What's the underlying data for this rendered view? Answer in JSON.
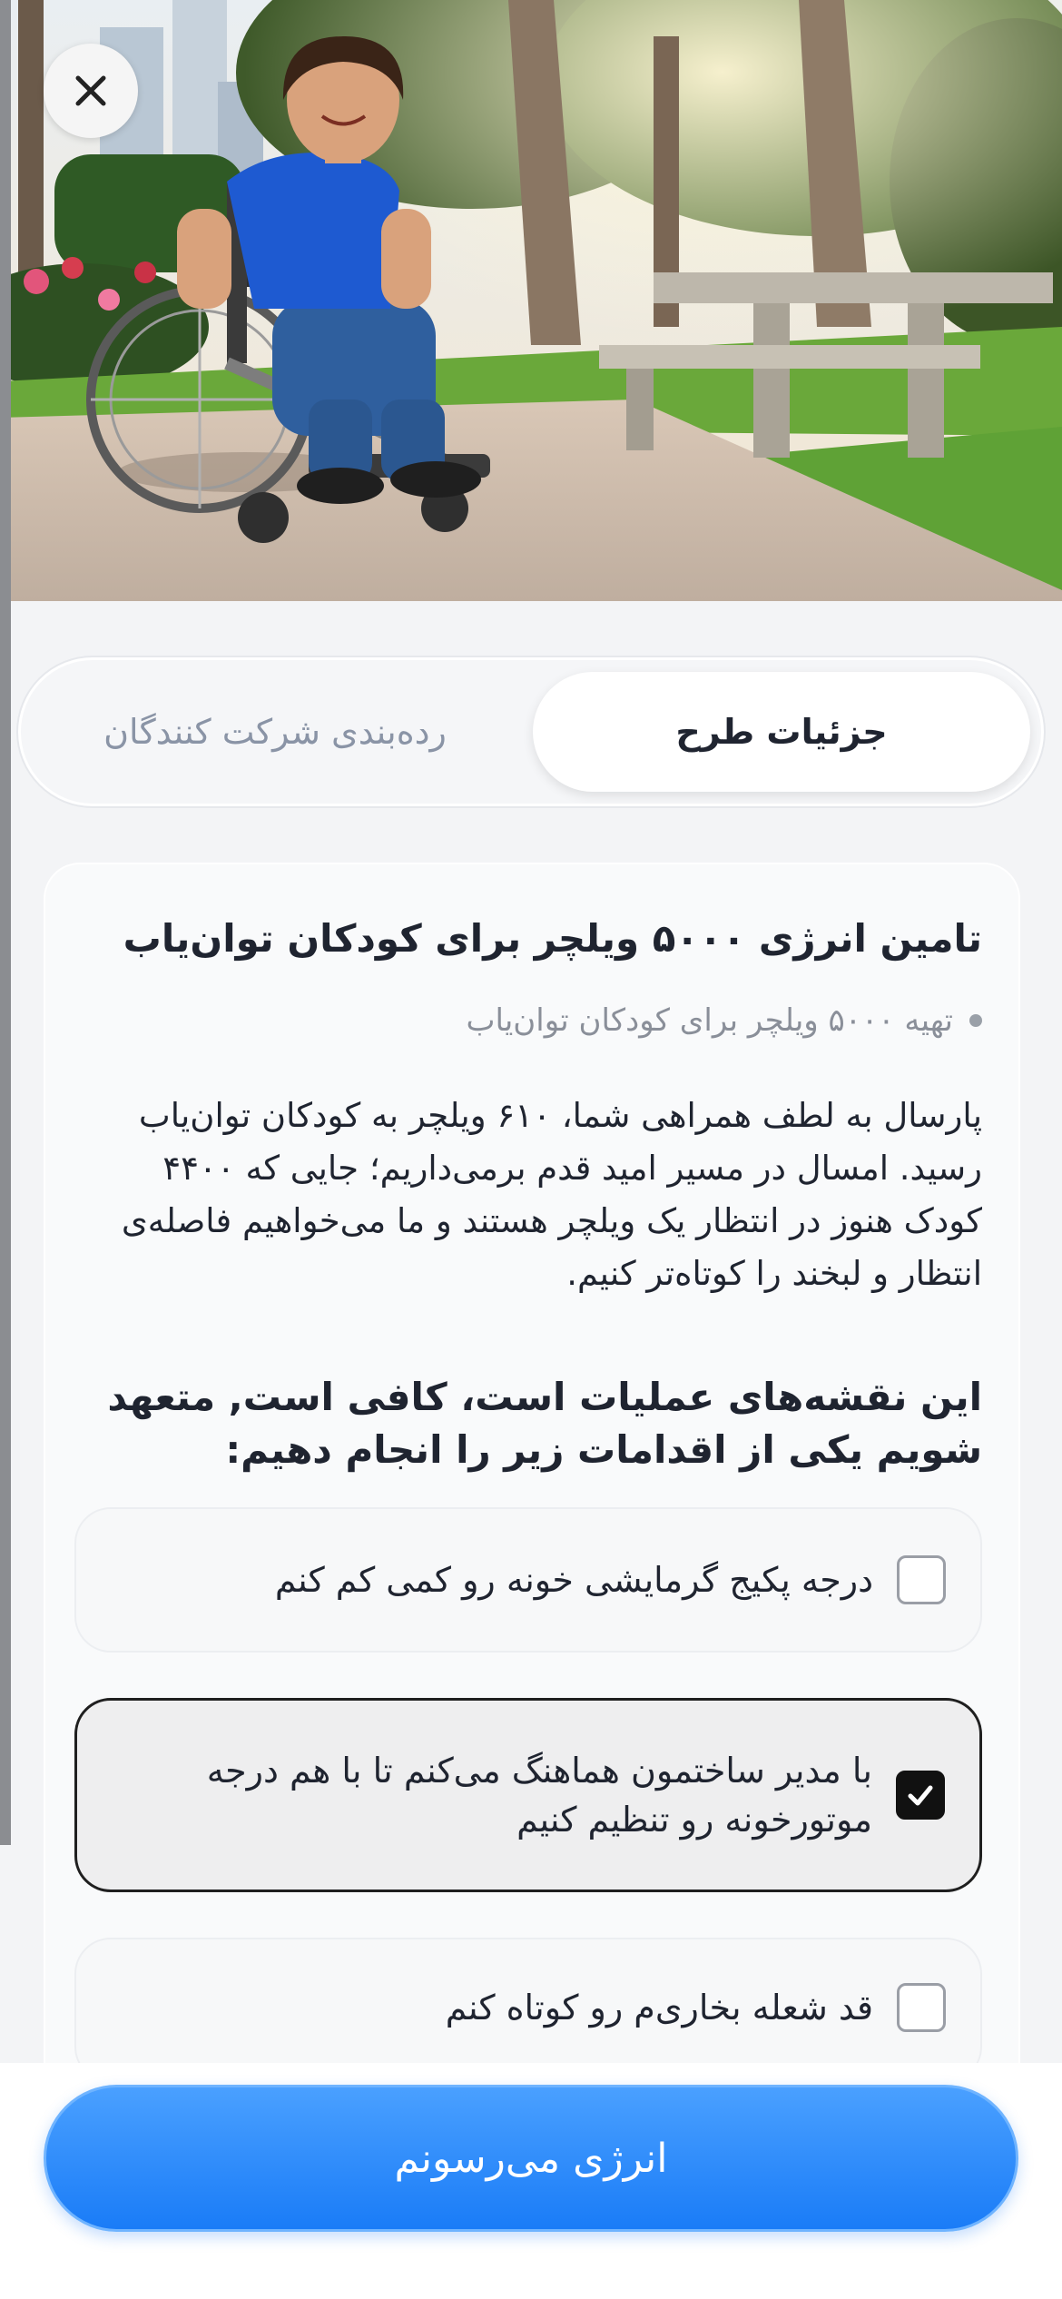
{
  "header": {
    "close_icon": "close-icon"
  },
  "tabs": [
    {
      "label": "جزئیات طرح",
      "active": true
    },
    {
      "label": "رده‌بندی شرکت کنندگان",
      "active": false
    }
  ],
  "campaign": {
    "title": "تامین انرژی ۵۰۰۰ ویلچر برای کودکان توان‌یاب",
    "bullet": "تهیه ۵۰۰۰ ویلچر برای کودکان توان‌یاب",
    "description": "پارسال به لطف همراهی شما، ۶۱۰ ویلچر به کودکان توان‌یاب رسید. امسال در مسیر امید قدم برمی‌داریم؛ جایی که ۴۴۰۰ کودک هنوز در انتظار یک ویلچر هستند و ما می‌خواهیم فاصله‌ی انتظار و لبخند را کوتاه‌تر کنیم.",
    "prompt": "این نقشه‌های عملیات است، کافی است, متعهد شویم یکی از اقدامات زیر را انجام دهیم:"
  },
  "options": [
    {
      "label": "درجه پکیج گرمایشی خونه رو کمی کم کنم",
      "checked": false
    },
    {
      "label": "با مدیر ساختمون هماهنگ می‌کنم تا با هم درجه موتورخونه رو تنظیم کنیم",
      "checked": true
    },
    {
      "label": "قد شعله بخاری‌م رو کوتاه کنم",
      "checked": false
    }
  ],
  "cta": {
    "label": "انرژی می‌رسونم",
    "color": "#1a7cf7"
  }
}
